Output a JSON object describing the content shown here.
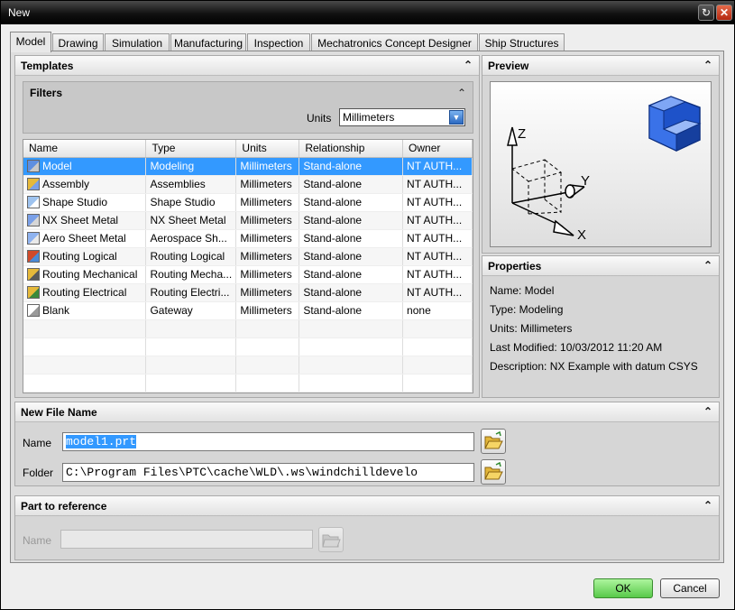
{
  "window": {
    "title": "New"
  },
  "tabs": [
    "Model",
    "Drawing",
    "Simulation",
    "Manufacturing",
    "Inspection",
    "Mechatronics Concept Designer",
    "Ship Structures"
  ],
  "templates": {
    "heading": "Templates",
    "filters": {
      "heading": "Filters",
      "units_label": "Units",
      "units_value": "Millimeters"
    },
    "columns": [
      "Name",
      "Type",
      "Units",
      "Relationship",
      "Owner"
    ],
    "rows": [
      {
        "name": "Model",
        "type": "Modeling",
        "units": "Millimeters",
        "relationship": "Stand-alone",
        "owner": "NT AUTH...",
        "icon": "model-icon"
      },
      {
        "name": "Assembly",
        "type": "Assemblies",
        "units": "Millimeters",
        "relationship": "Stand-alone",
        "owner": "NT AUTH...",
        "icon": "assembly-icon"
      },
      {
        "name": "Shape Studio",
        "type": "Shape Studio",
        "units": "Millimeters",
        "relationship": "Stand-alone",
        "owner": "NT AUTH...",
        "icon": "shape-studio-icon"
      },
      {
        "name": "NX Sheet Metal",
        "type": "NX Sheet Metal",
        "units": "Millimeters",
        "relationship": "Stand-alone",
        "owner": "NT AUTH...",
        "icon": "sheet-metal-icon"
      },
      {
        "name": "Aero Sheet Metal",
        "type": "Aerospace Sh...",
        "units": "Millimeters",
        "relationship": "Stand-alone",
        "owner": "NT AUTH...",
        "icon": "aero-sheet-metal-icon"
      },
      {
        "name": "Routing Logical",
        "type": "Routing Logical",
        "units": "Millimeters",
        "relationship": "Stand-alone",
        "owner": "NT AUTH...",
        "icon": "routing-logical-icon"
      },
      {
        "name": "Routing Mechanical",
        "type": "Routing Mecha...",
        "units": "Millimeters",
        "relationship": "Stand-alone",
        "owner": "NT AUTH...",
        "icon": "routing-mechanical-icon"
      },
      {
        "name": "Routing Electrical",
        "type": "Routing Electri...",
        "units": "Millimeters",
        "relationship": "Stand-alone",
        "owner": "NT AUTH...",
        "icon": "routing-electrical-icon"
      },
      {
        "name": "Blank",
        "type": "Gateway",
        "units": "Millimeters",
        "relationship": "Stand-alone",
        "owner": "none",
        "icon": "blank-icon"
      }
    ],
    "selected_index": 0
  },
  "preview": {
    "heading": "Preview",
    "axis_z": "Z",
    "axis_y": "Y",
    "axis_x": "X"
  },
  "properties": {
    "heading": "Properties",
    "lines": [
      "Name: Model",
      "Type: Modeling",
      "Units: Millimeters",
      "Last Modified: 10/03/2012 11:20 AM",
      "Description: NX Example with datum CSYS"
    ]
  },
  "new_file": {
    "heading": "New File Name",
    "name_label": "Name",
    "name_value": "model1.prt",
    "folder_label": "Folder",
    "folder_value": "C:\\Program Files\\PTC\\cache\\WLD\\.ws\\windchilldevelo"
  },
  "part_reference": {
    "heading": "Part to reference",
    "name_label": "Name",
    "name_value": ""
  },
  "buttons": {
    "ok": "OK",
    "cancel": "Cancel"
  },
  "colors": {
    "selection": "#3399ff",
    "ok_button": "#6ad35a",
    "cube": "#2b5fd6"
  }
}
